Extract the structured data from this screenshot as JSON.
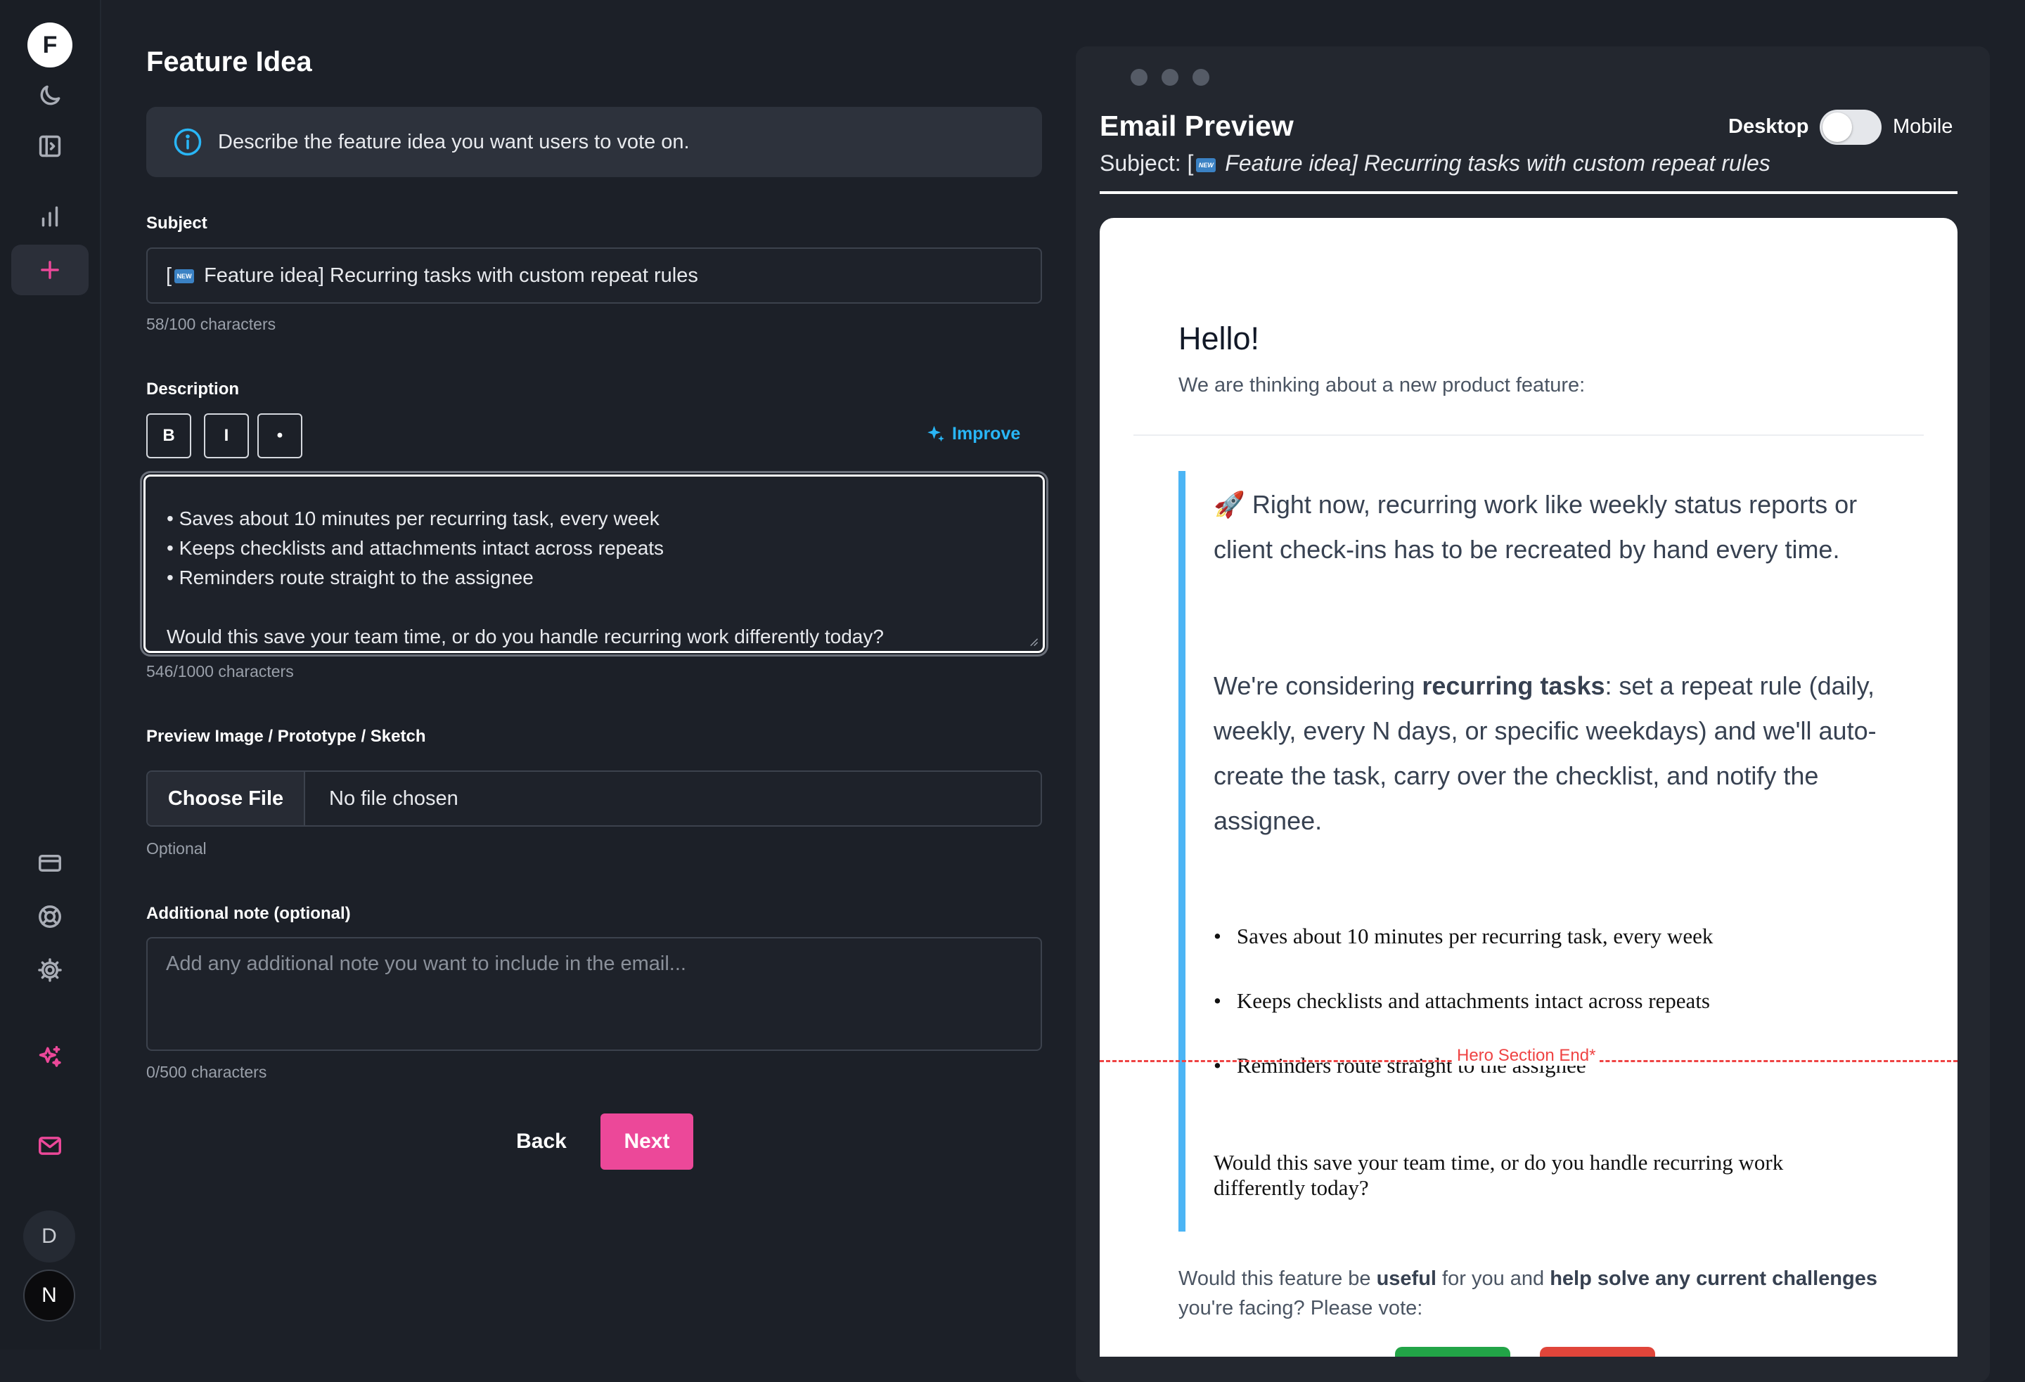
{
  "sidebar": {
    "logo_text": "F",
    "user_initial": "D",
    "brand_initial": "N"
  },
  "form": {
    "title": "Feature Idea",
    "info_text": "Describe the feature idea you want users to vote on.",
    "subject_label": "Subject",
    "subject_value": "Feature idea] Recurring tasks with custom repeat rules",
    "subject_count": "58/100 characters",
    "description_label": "Description",
    "format_buttons": [
      "B",
      "I",
      "•"
    ],
    "improve_label": "Improve",
    "description_lines": [
      "• Saves about 10 minutes per recurring task, every week",
      "• Keeps checklists and attachments intact across repeats",
      "• Reminders route straight to the assignee",
      "",
      "Would this save your team time, or do you handle recurring work differently today?"
    ],
    "description_count": "546/1000 characters",
    "image_label": "Preview Image / Prototype / Sketch",
    "choose_file": "Choose File",
    "no_file": "No file chosen",
    "image_hint": "Optional",
    "note_label": "Additional note (optional)",
    "note_placeholder": "Add any additional note you want to include in the email...",
    "note_count": "0/500 characters",
    "back": "Back",
    "next": "Next"
  },
  "preview": {
    "title": "Email Preview",
    "desktop": "Desktop",
    "mobile": "Mobile",
    "toggle_on_mobile": false,
    "subject_prefix": "Subject: [",
    "subject_text": " Feature idea] Recurring tasks with custom repeat rules",
    "hero_end": "Hero Section End*",
    "email": {
      "hello": "Hello!",
      "intro": "We are thinking about a new product feature:",
      "p1": "🚀  Right now, recurring work like weekly status reports or client check-ins has to be recreated by hand every time.",
      "p2_before": "We're considering ",
      "p2_bold": "recurring tasks",
      "p2_after": ": set a repeat rule (daily, weekly, every N days, or specific weekdays) and we'll auto-create the task, carry over the checklist, and notify the assignee.",
      "bullets": [
        "Saves about 10 minutes per recurring task, every week",
        "Keeps checklists and attachments intact across repeats",
        "Reminders route straight to the assignee"
      ],
      "question": "Would this save your team time, or do you handle recurring work differently today?",
      "vote_1": "Would this feature be ",
      "vote_b1": "useful",
      "vote_2": " for you and ",
      "vote_b2": "help solve any current challenges",
      "vote_3": " you're facing? Please vote:"
    }
  },
  "colors": {
    "accent": "#ec4899",
    "link": "#29b6f6",
    "quote_bar": "#4cb5f5",
    "hero_line": "#ef4444"
  }
}
